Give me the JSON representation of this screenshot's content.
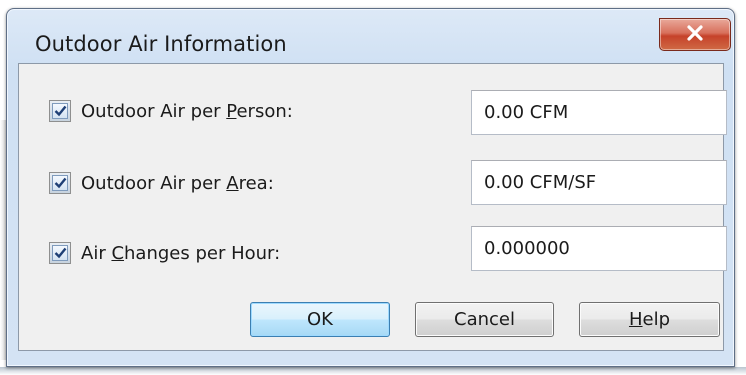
{
  "window": {
    "title": "Outdoor Air Information",
    "close_symbol": "X"
  },
  "rows": [
    {
      "checked": true,
      "label_pre": "Outdoor Air per ",
      "label_ul": "P",
      "label_post": "erson:",
      "value": "0.00 CFM"
    },
    {
      "checked": true,
      "label_pre": "Outdoor Air per ",
      "label_ul": "A",
      "label_post": "rea:",
      "value": "0.00 CFM/SF"
    },
    {
      "checked": true,
      "label_pre": "Air ",
      "label_ul": "C",
      "label_post": "hanges per Hour:",
      "value": "0.000000"
    }
  ],
  "buttons": {
    "ok": "OK",
    "cancel": "Cancel",
    "help_ul": "H",
    "help_rest": "elp"
  },
  "colors": {
    "close_red": "#c6422a",
    "checkmark": "#1f3f75",
    "default_button_border": "#3c7fb1"
  }
}
